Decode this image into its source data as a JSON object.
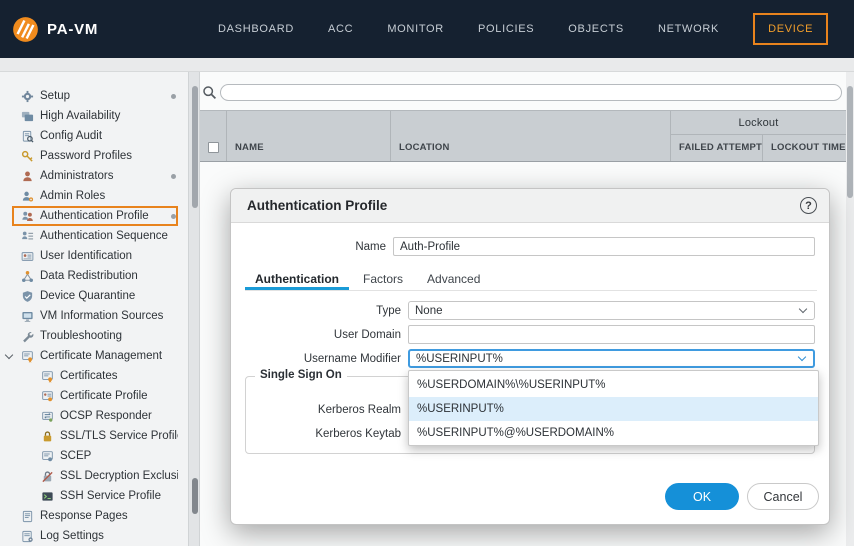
{
  "colors": {
    "nav_bg": "#152130",
    "accent_orange": "#e8831d",
    "nav_active_text": "#f09d2b",
    "accent_blue": "#1a9bd7",
    "ok_blue": "#1590d8",
    "header_gray": "#c9ced2",
    "option_selected_bg": "#dceefb"
  },
  "nav": {
    "brand": "PA-VM",
    "items": [
      "DASHBOARD",
      "ACC",
      "MONITOR",
      "POLICIES",
      "OBJECTS",
      "NETWORK",
      "DEVICE"
    ],
    "active_item": "DEVICE"
  },
  "search": {
    "value": ""
  },
  "table": {
    "group_header": "Lockout",
    "columns": [
      "NAME",
      "LOCATION",
      "FAILED ATTEMPTS (#)",
      "LOCKOUT TIME (MIN)"
    ]
  },
  "sidebar": {
    "items": [
      {
        "label": "Setup",
        "dot": true
      },
      {
        "label": "High Availability"
      },
      {
        "label": "Config Audit"
      },
      {
        "label": "Password Profiles"
      },
      {
        "label": "Administrators",
        "dot": true
      },
      {
        "label": "Admin Roles"
      },
      {
        "label": "Authentication Profile",
        "selected": true,
        "dot": true
      },
      {
        "label": "Authentication Sequence"
      },
      {
        "label": "User Identification"
      },
      {
        "label": "Data Redistribution"
      },
      {
        "label": "Device Quarantine"
      },
      {
        "label": "VM Information Sources"
      },
      {
        "label": "Troubleshooting"
      },
      {
        "label": "Certificate Management",
        "expanded": true
      },
      {
        "label": "Certificates",
        "child": true
      },
      {
        "label": "Certificate Profile",
        "child": true
      },
      {
        "label": "OCSP Responder",
        "child": true
      },
      {
        "label": "SSL/TLS Service Profile",
        "child": true
      },
      {
        "label": "SCEP",
        "child": true
      },
      {
        "label": "SSL Decryption Exclusio",
        "child": true
      },
      {
        "label": "SSH Service Profile",
        "child": true
      },
      {
        "label": "Response Pages"
      },
      {
        "label": "Log Settings"
      }
    ]
  },
  "dialog": {
    "title": "Authentication Profile",
    "help_glyph": "?",
    "tabs": [
      {
        "label": "Authentication",
        "active": true
      },
      {
        "label": "Factors"
      },
      {
        "label": "Advanced"
      }
    ],
    "fields": {
      "name_label": "Name",
      "name_value": "Auth-Profile",
      "type_label": "Type",
      "type_value": "None",
      "user_domain_label": "User Domain",
      "user_domain_value": "",
      "username_modifier_label": "Username Modifier",
      "username_modifier_value": "%USERINPUT%"
    },
    "dropdown_options": [
      {
        "label": "%USERDOMAIN%\\%USERINPUT%"
      },
      {
        "label": "%USERINPUT%",
        "selected": true
      },
      {
        "label": "%USERINPUT%@%USERDOMAIN%"
      }
    ],
    "sso": {
      "legend": "Single Sign On",
      "kerberos_realm_label": "Kerberos Realm",
      "kerberos_keytab_label": "Kerberos Keytab"
    },
    "buttons": {
      "ok": "OK",
      "cancel": "Cancel"
    }
  }
}
